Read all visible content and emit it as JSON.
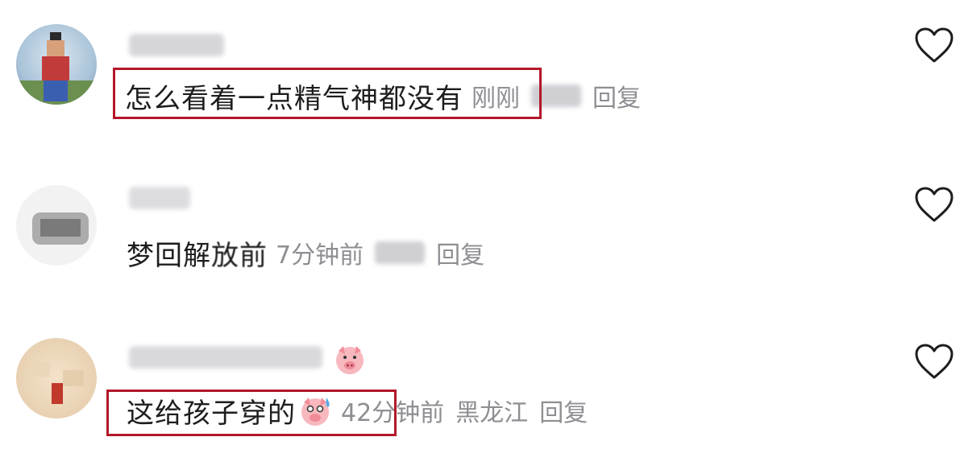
{
  "comments": [
    {
      "text": "怎么看着一点精气神都没有",
      "time": "刚刚",
      "reply": "回复"
    },
    {
      "text_part1": "梦回解",
      "text_part2": "放前",
      "time": "7分钟前",
      "reply": "回复"
    },
    {
      "text": "这给孩子穿的",
      "time": "42分钟前",
      "location": "黑龙江",
      "reply": "回复"
    }
  ],
  "icons": {
    "like": "heart-outline-icon",
    "pig": "pig-emoji",
    "sweat": "pig-sweat-emoji"
  },
  "colors": {
    "highlight": "#b3172a",
    "meta": "#8e8e93"
  }
}
